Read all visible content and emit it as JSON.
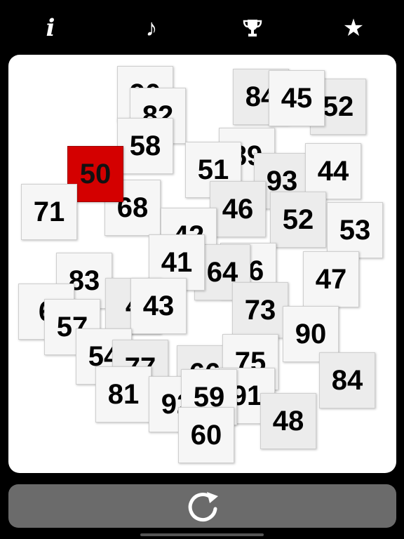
{
  "toolbar": {
    "info_icon": "info-icon",
    "music_icon": "music-note-icon",
    "trophy_icon": "trophy-icon",
    "star_icon": "star-icon"
  },
  "board": {
    "highlight_color": "#d40000",
    "tiles": [
      "90",
      "82",
      "58",
      "84",
      "45",
      "52",
      "89",
      "93",
      "50",
      "51",
      "44",
      "71",
      "68",
      "46",
      "52",
      "53",
      "42",
      "41",
      "64",
      "83",
      "47",
      "86",
      "6",
      "43",
      "73",
      "4",
      "57",
      "90",
      "54",
      "77",
      "66",
      "75",
      "81",
      "92",
      "59",
      "91",
      "84",
      "48",
      "60"
    ]
  },
  "bottom": {
    "refresh_icon": "refresh-icon"
  }
}
